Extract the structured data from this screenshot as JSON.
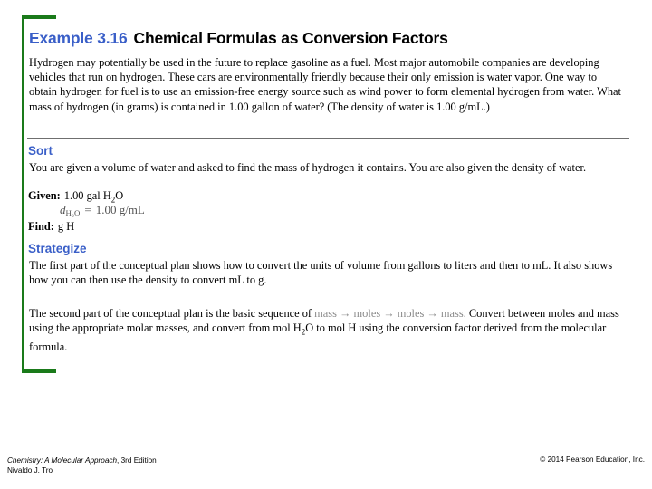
{
  "slide": {
    "example_label": "Example 3.16",
    "title": "Chemical Formulas as Conversion Factors",
    "problem_statement": "Hydrogen may potentially be used in the future to replace gasoline as a fuel. Most major automobile companies are developing vehicles that run on hydrogen. These cars are environmentally friendly because their only emission is water vapor. One way to obtain hydrogen for fuel is to use an emission-free energy source such as wind power to form elemental hydrogen from water. What mass of hydrogen (in grams) is contained in 1.00 gallon of water? (The density of water is 1.00 g/mL.)"
  },
  "sort": {
    "heading": "Sort",
    "text": "You are given a volume of water and asked to find the mass of hydrogen it contains. You are also given the density of water.",
    "given_label": "Given:",
    "given_value_pre": "1.00 gal H",
    "given_value_sub": "2",
    "given_value_post": "O",
    "find_label": "Find:",
    "find_value": "g H",
    "equation": {
      "variable": "d",
      "variable_sub": "H₂O",
      "equals": "=",
      "value": "1.00 g/mL"
    }
  },
  "strategize": {
    "heading": "Strategize",
    "paragraph_1": "The first part of the conceptual plan shows how to convert the units of volume from gallons to liters and then to mL. It also shows how you can then use the density to convert mL to g.",
    "paragraph_2_pre": "The second part of the conceptual plan is the basic sequence of",
    "sequence": "mass → moles → moles → mass.",
    "paragraph_2_post_a": "Convert between moles and mass using the appropriate molar masses, and convert from mol H",
    "paragraph_2_sub": "2",
    "paragraph_2_post_b": "O to mol H using the conversion factor derived from the molecular formula."
  },
  "footer": {
    "book_title": "Chemistry: A Molecular Approach",
    "edition": ", 3rd Edition",
    "author": "Nivaldo J. Tro",
    "copyright": "© 2014 Pearson Education, Inc."
  },
  "colors": {
    "accent_blue": "#3a5fc8",
    "frame_green": "#1a7a1a",
    "divider_gray": "#6f6f6f",
    "sequence_gray": "#8a8a8a"
  }
}
